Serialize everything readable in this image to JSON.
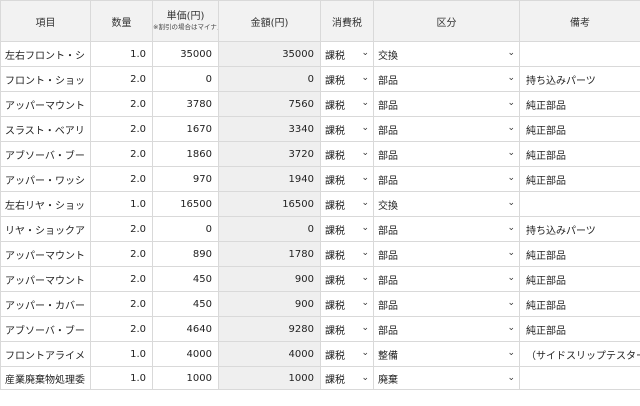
{
  "headers": {
    "item": "項目",
    "qty": "数量",
    "unit_price": "単価(円)",
    "unit_price_note": "※割引の場合はマイナス値を入力",
    "amount": "金額(円)",
    "tax": "消費税",
    "category": "区分",
    "note": "備考"
  },
  "rows": [
    {
      "item": "左右フロント・シ",
      "qty": "1.0",
      "price": "35000",
      "amount": "35000",
      "tax": "課税",
      "category": "交換",
      "note": ""
    },
    {
      "item": "フロント・ショッ",
      "qty": "2.0",
      "price": "0",
      "amount": "0",
      "tax": "課税",
      "category": "部品",
      "note": "持ち込みパーツ"
    },
    {
      "item": "アッパーマウント",
      "qty": "2.0",
      "price": "3780",
      "amount": "7560",
      "tax": "課税",
      "category": "部品",
      "note": "純正部品"
    },
    {
      "item": "スラスト・ベアリ",
      "qty": "2.0",
      "price": "1670",
      "amount": "3340",
      "tax": "課税",
      "category": "部品",
      "note": "純正部品"
    },
    {
      "item": "アブソーバ・ブー",
      "qty": "2.0",
      "price": "1860",
      "amount": "3720",
      "tax": "課税",
      "category": "部品",
      "note": "純正部品"
    },
    {
      "item": "アッパー・ワッシ",
      "qty": "2.0",
      "price": "970",
      "amount": "1940",
      "tax": "課税",
      "category": "部品",
      "note": "純正部品"
    },
    {
      "item": "左右リヤ・ショッ",
      "qty": "1.0",
      "price": "16500",
      "amount": "16500",
      "tax": "課税",
      "category": "交換",
      "note": ""
    },
    {
      "item": "リヤ・ショックア",
      "qty": "2.0",
      "price": "0",
      "amount": "0",
      "tax": "課税",
      "category": "部品",
      "note": "持ち込みパーツ"
    },
    {
      "item": "アッパーマウント",
      "qty": "2.0",
      "price": "890",
      "amount": "1780",
      "tax": "課税",
      "category": "部品",
      "note": "純正部品"
    },
    {
      "item": "アッパーマウント",
      "qty": "2.0",
      "price": "450",
      "amount": "900",
      "tax": "課税",
      "category": "部品",
      "note": "純正部品"
    },
    {
      "item": "アッパー・カバー",
      "qty": "2.0",
      "price": "450",
      "amount": "900",
      "tax": "課税",
      "category": "部品",
      "note": "純正部品"
    },
    {
      "item": "アブソーバ・ブー",
      "qty": "2.0",
      "price": "4640",
      "amount": "9280",
      "tax": "課税",
      "category": "部品",
      "note": "純正部品"
    },
    {
      "item": "フロントアライメ",
      "qty": "1.0",
      "price": "4000",
      "amount": "4000",
      "tax": "課税",
      "category": "整備",
      "note": "（サイドスリップテスター"
    },
    {
      "item": "産業廃棄物処理委",
      "qty": "1.0",
      "price": "1000",
      "amount": "1000",
      "tax": "課税",
      "category": "廃棄",
      "note": ""
    }
  ],
  "icons": {
    "dropdown": "chevron-down-icon"
  }
}
